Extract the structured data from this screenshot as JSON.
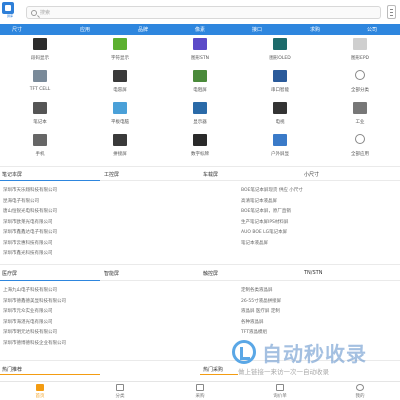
{
  "header": {
    "logo_text": "屏库",
    "search_placeholder": "搜索"
  },
  "nav": [
    "尺寸",
    "应用",
    "品牌",
    "像素",
    "接口",
    "求购",
    "公司"
  ],
  "categories": [
    {
      "label": "段码显示",
      "icon": "segment-lcd-icon",
      "color": "#2c2c2c"
    },
    {
      "label": "字符显示",
      "icon": "character-lcd-icon",
      "color": "#5cb030"
    },
    {
      "label": "图形STN",
      "icon": "graphic-stn-icon",
      "color": "#5b4ac8"
    },
    {
      "label": "图形OLED",
      "icon": "graphic-oled-icon",
      "color": "#1d6b6b"
    },
    {
      "label": "图形EPD",
      "icon": "graphic-epd-icon",
      "color": "#cfcfcf"
    },
    {
      "label": "TFT CELL",
      "icon": "tft-cell-icon",
      "color": "#7a8a99"
    },
    {
      "label": "电容屏",
      "icon": "capacitive-screen-icon",
      "color": "#3a3a3a"
    },
    {
      "label": "电阻屏",
      "icon": "resistive-screen-icon",
      "color": "#4a8a3a"
    },
    {
      "label": "串口智能",
      "icon": "serial-smart-icon",
      "color": "#2a5a9a"
    },
    {
      "label": "全部分类",
      "icon": "all-categories-icon",
      "color": "#888888"
    },
    {
      "label": "笔记本",
      "icon": "laptop-icon",
      "color": "#555555"
    },
    {
      "label": "平板电脑",
      "icon": "tablet-icon",
      "color": "#4aa0d8"
    },
    {
      "label": "显示器",
      "icon": "monitor-icon",
      "color": "#2a6aa8"
    },
    {
      "label": "电视",
      "icon": "tv-icon",
      "color": "#333333"
    },
    {
      "label": "工业",
      "icon": "industrial-icon",
      "color": "#777777"
    },
    {
      "label": "手机",
      "icon": "phone-icon",
      "color": "#666666"
    },
    {
      "label": "拼接屏",
      "icon": "splicing-screen-icon",
      "color": "#3a3a3a"
    },
    {
      "label": "数字标牌",
      "icon": "digital-signage-icon",
      "color": "#2a2a2a"
    },
    {
      "label": "户外屏显",
      "icon": "outdoor-display-icon",
      "color": "#3a7ac8"
    },
    {
      "label": "全部应用",
      "icon": "all-applications-icon",
      "color": "#888888"
    }
  ],
  "section1": {
    "headers": [
      "笔记本屏",
      "工控屏",
      "车载屏",
      "小尺寸"
    ],
    "companies": [
      "深圳市天乐翔科技有限公司",
      "昆海电子有限公司",
      "唐山恒锐光电科技有限公司",
      "深圳市欧莱光电有限公司",
      "深圳市鑫鑫达电子有限公司",
      "深圳市云惠科技有限公司",
      "深圳市鑫光科技有限公司"
    ],
    "items": [
      "BOE笔记本屏现货 供应 小尺寸",
      "高清笔记本液晶屏",
      "BOE笔记本屏，原厂直销",
      "生产笔记本屏IPS材料屏",
      "AUO BOE LG笔记本屏",
      "笔记本液晶屏"
    ]
  },
  "section2": {
    "headers": [
      "医疗屏",
      "智能屏",
      "触控屏",
      "TN/STN"
    ],
    "companies": [
      "上海九山电子科技有限公司",
      "深圳市德鑫德美显科技有限公司",
      "深圳市元众实业有限公司",
      "深圳市海湛光电有限公司",
      "深圳市明元达科技有限公司",
      "深圳市德博德科技企业有限公司"
    ],
    "items": [
      "定制各类液晶屏",
      "26-55寸液晶拼接屏",
      "液晶屏 医疗屏 定制",
      "各种液晶屏",
      "TFT液晶模组"
    ]
  },
  "section3": {
    "headers": [
      "热门推荐",
      "热门采购"
    ]
  },
  "watermark": {
    "title": "自动秒收录",
    "subtitle": "做上链接一来访一次一自动收录"
  },
  "tabs": [
    {
      "label": "首页",
      "icon": "home-icon",
      "active": true
    },
    {
      "label": "分类",
      "icon": "category-icon",
      "active": false
    },
    {
      "label": "采购",
      "icon": "purchase-icon",
      "active": false
    },
    {
      "label": "询价单",
      "icon": "inquiry-icon",
      "active": false
    },
    {
      "label": "我的",
      "icon": "profile-icon",
      "active": false
    }
  ],
  "colors": {
    "accent": "#2e86de",
    "secondary": "#f39c12"
  }
}
